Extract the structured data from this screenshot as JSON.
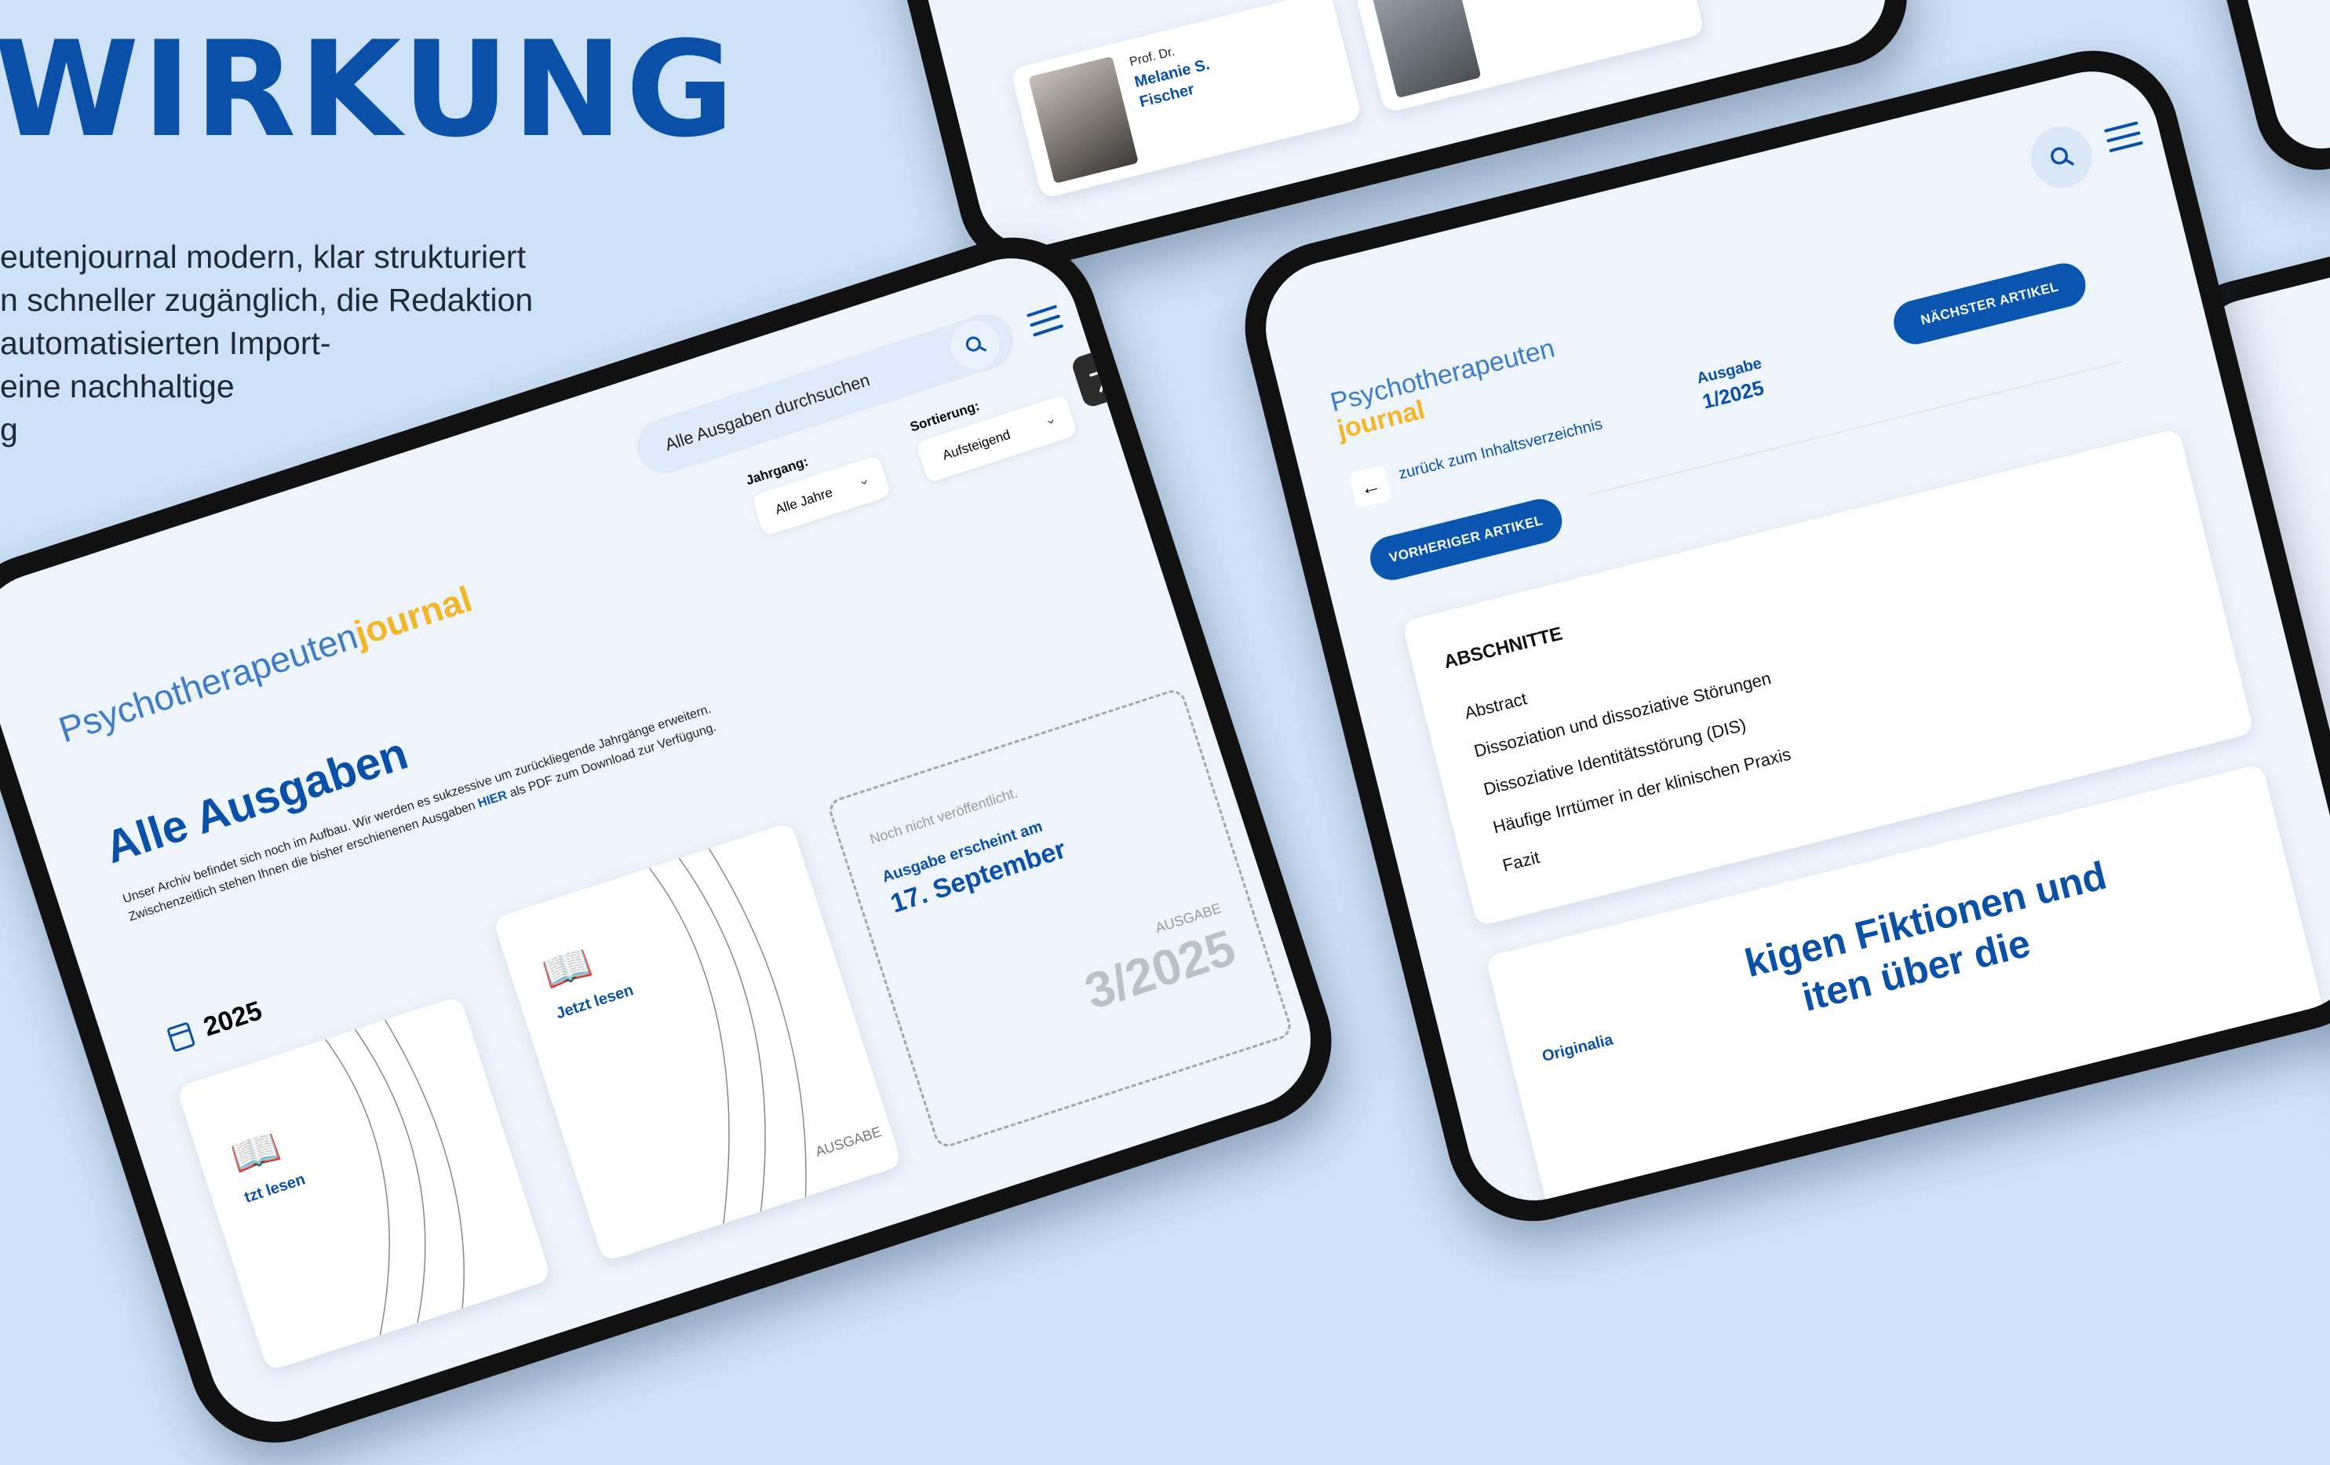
{
  "hero": {
    "title": "WIRKUNG",
    "lines": [
      "eutenjournal modern, klar strukturiert",
      "n schneller zugänglich, die Redaktion",
      "automatisierten Import-",
      " eine  nachhaltige",
      "g"
    ]
  },
  "top_tablet": {
    "author_prefix": "Prof. Dr.",
    "author_name_1": "Melanie S.",
    "author_name_2": "Fischer"
  },
  "archive_tablet": {
    "logo_part1": "Psychotherapeuten",
    "logo_part2": "journal",
    "search_placeholder": "Alle Ausgaben durchsuchen",
    "year_label": "Jahrgang:",
    "year_value": "Alle Jahre",
    "sort_label": "Sortierung:",
    "sort_value": "Aufsteigend",
    "page_title": "Alle Ausgaben",
    "intro_line1": "Unser Archiv befindet sich noch im Aufbau. Wir werden es sukzessive um zurückliegende Jahrgänge erweitern.",
    "intro_line2_a": "Zwischenzeitlich stehen Ihnen die bisher erschienenen Ausgaben ",
    "intro_line2_link": "HIER",
    "intro_line2_b": " als PDF zum Download zur Verfügung.",
    "year_heading": "2025",
    "read_label": "Jetzt lesen",
    "read_label_partial": "tzt lesen",
    "issue_label": "AUSGABE",
    "upcoming_note": "Noch nicht veröffentlicht.",
    "upcoming_line1": "Ausgabe erscheint am",
    "upcoming_date": "17. September",
    "upcoming_issue_label": "AUSGABE",
    "upcoming_issue": "3/2025"
  },
  "article_tablet": {
    "logo_part1": "Psychotherapeuten",
    "logo_part2": "journal",
    "back_link": "zurück zum Inhaltsverzeichnis",
    "issue_label": "Ausgabe",
    "issue_value": "1/2025",
    "next_button": "NÄCHSTER ARTIKEL",
    "prev_button": "VORHERIGER ARTIKEL",
    "sections_title": "ABSCHNITTE",
    "sections": [
      "Abstract",
      "Dissoziation und dissoziative Störungen",
      "Dissoziative Identitätsstörung (DIS)",
      "Häufige Irrtümer in der klinischen Praxis",
      "Fazit"
    ],
    "category": "Originalia",
    "headline_line1": "kigen Fiktionen und",
    "headline_line2": "iten über die"
  }
}
